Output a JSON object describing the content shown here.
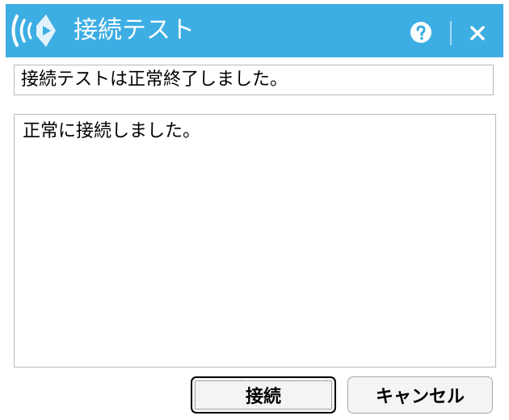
{
  "window": {
    "title": "接続テスト",
    "titlebar_color": "#3daee3",
    "logo_icon": "signal-wave-logo",
    "help_icon": "question-circle",
    "close_icon": "close-x"
  },
  "status": {
    "value": "接続テストは正常終了しました。"
  },
  "log": {
    "value": "正常に接続しました。"
  },
  "buttons": {
    "connect_label": "接続",
    "cancel_label": "キャンセル"
  }
}
